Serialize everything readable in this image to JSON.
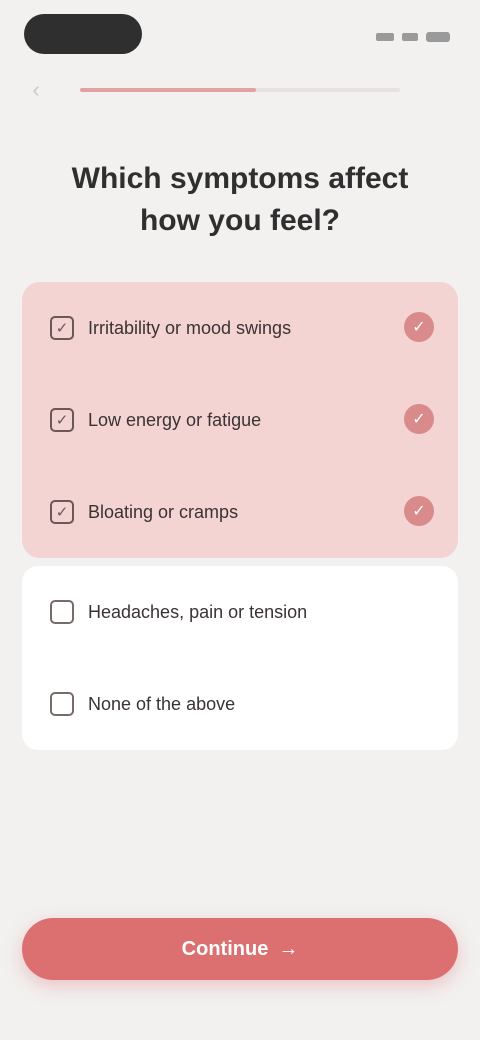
{
  "colors": {
    "accent": "#dc7070",
    "selected_bg": "#f4d3d3",
    "page_bg": "#f2f1f0",
    "progress_fill": "#e2a2a2"
  },
  "header": {
    "back_icon": "chevron-left-icon",
    "progress": 0.55
  },
  "question": "Which symptoms affect how you feel?",
  "options": [
    {
      "label": "Irritability or mood swings",
      "selected": true
    },
    {
      "label": "Low energy or fatigue",
      "selected": true
    },
    {
      "label": "Bloating or cramps",
      "selected": true
    },
    {
      "label": "Headaches, pain or tension",
      "selected": false
    },
    {
      "label": "None of the above",
      "selected": false
    }
  ],
  "cta": {
    "label": "Continue",
    "icon": "arrow-right-icon"
  }
}
